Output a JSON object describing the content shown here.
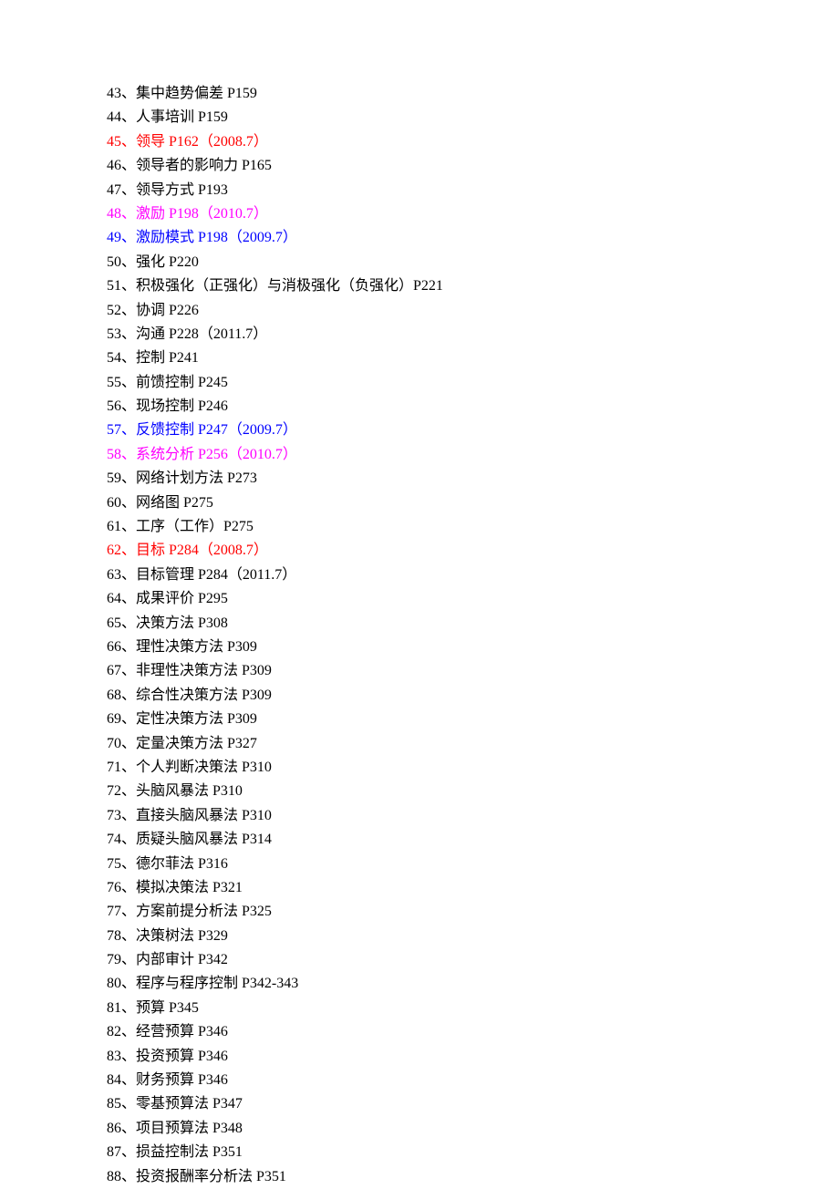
{
  "items": [
    {
      "text": "43、集中趋势偏差 P159",
      "color": "black"
    },
    {
      "text": "44、人事培训 P159",
      "color": "black"
    },
    {
      "text": "45、领导 P162（2008.7）",
      "color": "red"
    },
    {
      "text": "46、领导者的影响力 P165",
      "color": "black"
    },
    {
      "text": "47、领导方式 P193",
      "color": "black"
    },
    {
      "text": "48、激励 P198（2010.7）",
      "color": "pink"
    },
    {
      "text": "49、激励模式 P198（2009.7）",
      "color": "blue"
    },
    {
      "text": "50、强化 P220",
      "color": "black"
    },
    {
      "text": "51、积极强化（正强化）与消极强化（负强化）P221",
      "color": "black"
    },
    {
      "text": "52、协调 P226",
      "color": "black"
    },
    {
      "text": "53、沟通 P228（2011.7）",
      "color": "black"
    },
    {
      "text": "54、控制 P241",
      "color": "black"
    },
    {
      "text": "55、前馈控制 P245",
      "color": "black"
    },
    {
      "text": "56、现场控制 P246",
      "color": "black"
    },
    {
      "text": "57、反馈控制 P247（2009.7）",
      "color": "blue"
    },
    {
      "text": "58、系统分析 P256（2010.7）",
      "color": "pink"
    },
    {
      "text": "59、网络计划方法 P273",
      "color": "black"
    },
    {
      "text": "60、网络图 P275",
      "color": "black"
    },
    {
      "text": "61、工序（工作）P275",
      "color": "black"
    },
    {
      "text": "62、目标 P284（2008.7）",
      "color": "red"
    },
    {
      "text": "63、目标管理 P284（2011.7）",
      "color": "black"
    },
    {
      "text": "64、成果评价 P295",
      "color": "black"
    },
    {
      "text": "65、决策方法 P308",
      "color": "black"
    },
    {
      "text": "66、理性决策方法 P309",
      "color": "black"
    },
    {
      "text": "67、非理性决策方法 P309",
      "color": "black"
    },
    {
      "text": "68、综合性决策方法 P309",
      "color": "black"
    },
    {
      "text": "69、定性决策方法 P309",
      "color": "black"
    },
    {
      "text": "70、定量决策方法 P327",
      "color": "black"
    },
    {
      "text": "71、个人判断决策法 P310",
      "color": "black"
    },
    {
      "text": "72、头脑风暴法 P310",
      "color": "black"
    },
    {
      "text": "73、直接头脑风暴法 P310",
      "color": "black"
    },
    {
      "text": "74、质疑头脑风暴法 P314",
      "color": "black"
    },
    {
      "text": "75、德尔菲法 P316",
      "color": "black"
    },
    {
      "text": "76、模拟决策法 P321",
      "color": "black"
    },
    {
      "text": "77、方案前提分析法 P325",
      "color": "black"
    },
    {
      "text": "78、决策树法 P329",
      "color": "black"
    },
    {
      "text": "79、内部审计 P342",
      "color": "black"
    },
    {
      "text": "80、程序与程序控制 P342-343",
      "color": "black"
    },
    {
      "text": "81、预算 P345",
      "color": "black"
    },
    {
      "text": "82、经营预算 P346",
      "color": "black"
    },
    {
      "text": "83、投资预算 P346",
      "color": "black"
    },
    {
      "text": "84、财务预算 P346",
      "color": "black"
    },
    {
      "text": "85、零基预算法 P347",
      "color": "black"
    },
    {
      "text": "86、项目预算法 P348",
      "color": "black"
    },
    {
      "text": "87、损益控制法 P351",
      "color": "black"
    },
    {
      "text": "88、投资报酬率分析法 P351",
      "color": "black"
    }
  ]
}
